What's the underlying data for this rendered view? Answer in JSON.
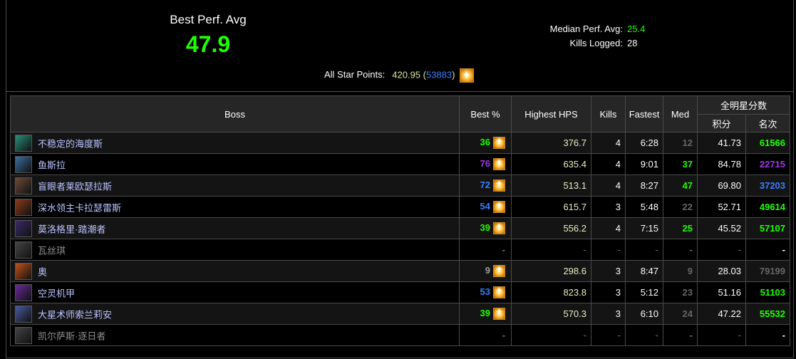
{
  "summary": {
    "best_label": "Best Perf. Avg",
    "best_value": "47.9",
    "median_label": "Median Perf. Avg:",
    "median_value": "25.4",
    "kills_label": "Kills Logged:",
    "kills_value": "28",
    "allstar_label": "All Star Points:",
    "allstar_points": "420.95",
    "allstar_rank": "53883",
    "allstar_open": "(",
    "allstar_close": ")"
  },
  "table": {
    "headers": {
      "boss": "Boss",
      "best_pct": "Best %",
      "highest_hps": "Highest HPS",
      "kills": "Kills",
      "fastest": "Fastest",
      "med": "Med",
      "allstar": "全明星分数",
      "points": "积分",
      "rank": "名次"
    },
    "rows": [
      {
        "name": "不稳定的海度斯",
        "best": "36",
        "best_color": "#1eff00",
        "hps": "376.7",
        "kills": "4",
        "fastest": "6:28",
        "med": "12",
        "med_color": "#666666",
        "points": "41.73",
        "rank": "61566",
        "rank_color": "#1eff00",
        "icon_color": "#2a8f7a"
      },
      {
        "name": "鱼斯拉",
        "best": "76",
        "best_color": "#a335ee",
        "hps": "635.4",
        "kills": "4",
        "fastest": "9:01",
        "med": "37",
        "med_color": "#1eff00",
        "points": "84.78",
        "rank": "22715",
        "rank_color": "#a335ee",
        "icon_color": "#3b6e9e"
      },
      {
        "name": "盲眼者莱欧瑟拉斯",
        "best": "72",
        "best_color": "#3a7fff",
        "hps": "513.1",
        "kills": "4",
        "fastest": "8:27",
        "med": "47",
        "med_color": "#1eff00",
        "points": "69.80",
        "rank": "37203",
        "rank_color": "#3a7fff",
        "icon_color": "#6a4a3a"
      },
      {
        "name": "深水领主卡拉瑟雷斯",
        "best": "54",
        "best_color": "#3a7fff",
        "hps": "615.7",
        "kills": "3",
        "fastest": "5:48",
        "med": "22",
        "med_color": "#666666",
        "points": "52.71",
        "rank": "49614",
        "rank_color": "#1eff00",
        "icon_color": "#8a3a1a"
      },
      {
        "name": "莫洛格里·踏潮者",
        "best": "39",
        "best_color": "#1eff00",
        "hps": "556.2",
        "kills": "4",
        "fastest": "7:15",
        "med": "25",
        "med_color": "#1eff00",
        "points": "45.52",
        "rank": "57107",
        "rank_color": "#1eff00",
        "icon_color": "#3a2a6a"
      },
      {
        "name": "瓦丝琪",
        "best": "-",
        "best_color": "#777777",
        "hps": "-",
        "kills": "-",
        "fastest": "-",
        "med": "-",
        "med_color": "#777777",
        "points": "-",
        "rank": "-",
        "rank_color": "#ffffff",
        "icon_color": "#444444",
        "dim": true
      },
      {
        "name": "奥",
        "best": "9",
        "best_color": "#9d9d9d",
        "hps": "298.6",
        "kills": "3",
        "fastest": "8:47",
        "med": "9",
        "med_color": "#666666",
        "points": "28.03",
        "rank": "79199",
        "rank_color": "#666666",
        "icon_color": "#c0501a"
      },
      {
        "name": "空灵机甲",
        "best": "53",
        "best_color": "#3a7fff",
        "hps": "823.8",
        "kills": "3",
        "fastest": "5:12",
        "med": "23",
        "med_color": "#666666",
        "points": "51.16",
        "rank": "51103",
        "rank_color": "#1eff00",
        "icon_color": "#6a2a9a"
      },
      {
        "name": "大星术师索兰莉安",
        "best": "39",
        "best_color": "#1eff00",
        "hps": "570.3",
        "kills": "3",
        "fastest": "6:10",
        "med": "24",
        "med_color": "#666666",
        "points": "47.22",
        "rank": "55532",
        "rank_color": "#1eff00",
        "icon_color": "#4a5aa0"
      },
      {
        "name": "凯尔萨斯·逐日者",
        "best": "-",
        "best_color": "#777777",
        "hps": "-",
        "kills": "-",
        "fastest": "-",
        "med": "-",
        "med_color": "#777777",
        "points": "-",
        "rank": "-",
        "rank_color": "#ffffff",
        "icon_color": "#444444",
        "dim": true
      }
    ]
  },
  "icons": {
    "star": "allstar-star-icon"
  }
}
